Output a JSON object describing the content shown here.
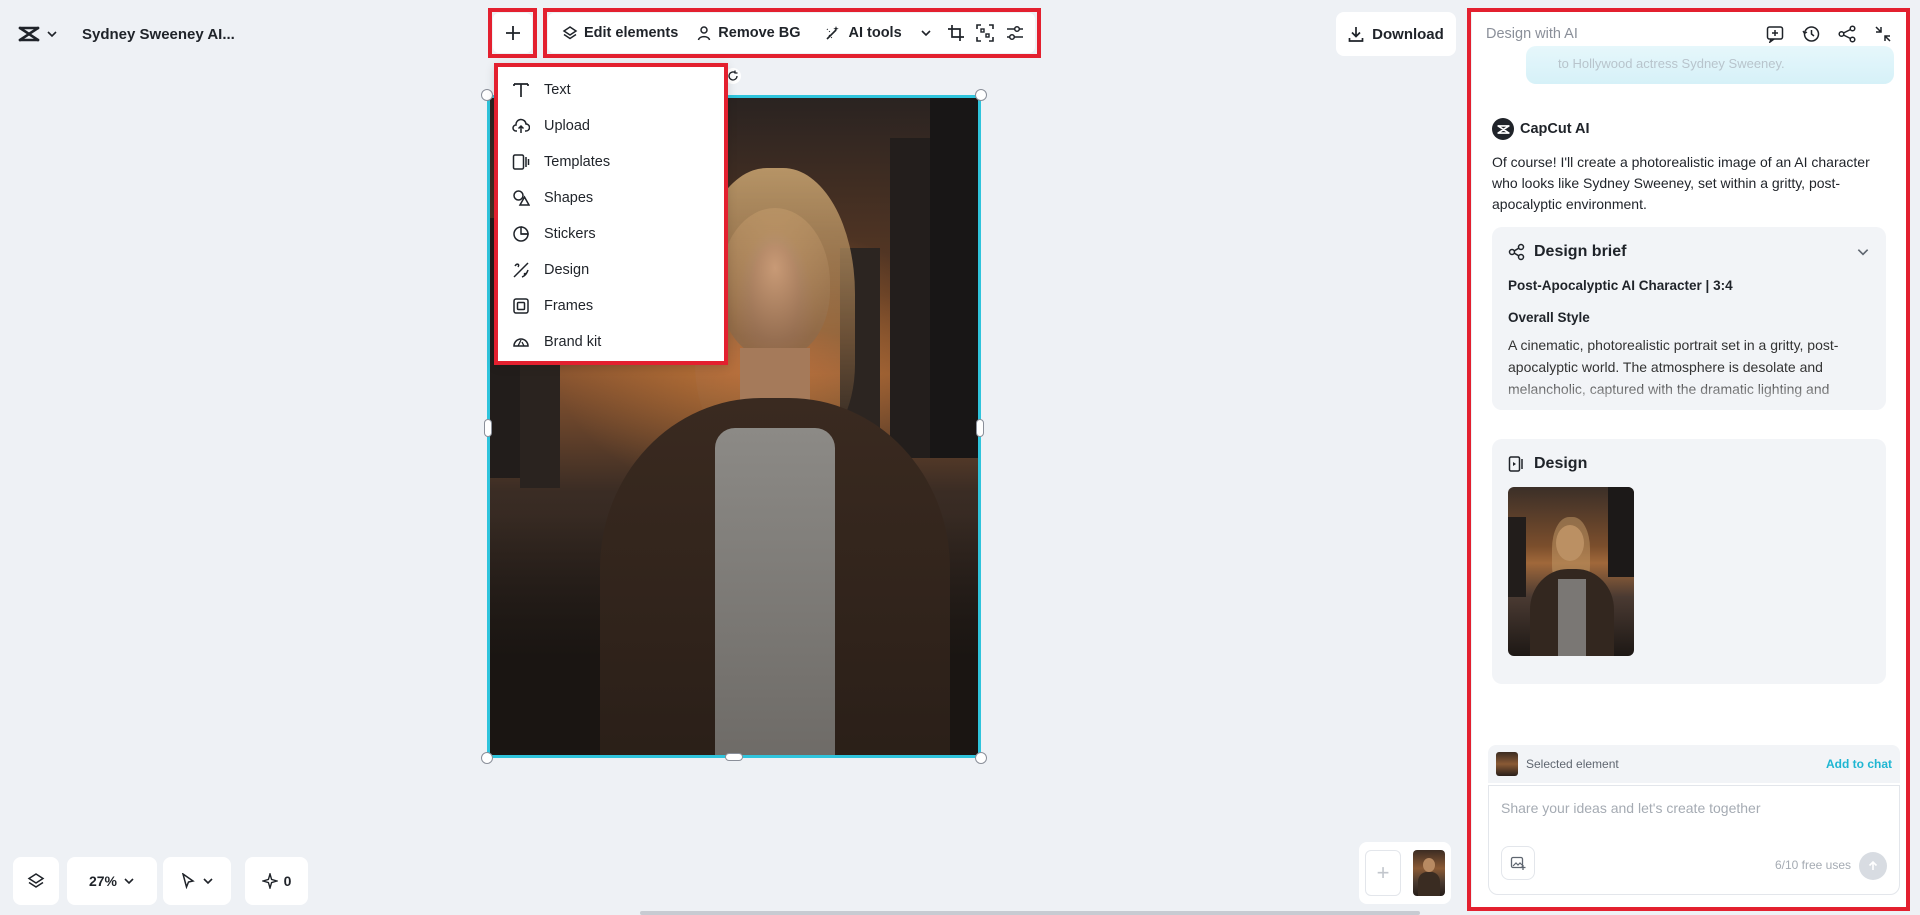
{
  "project": {
    "title": "Sydney Sweeney AI..."
  },
  "toolbar": {
    "edit_elements": "Edit elements",
    "remove_bg": "Remove BG",
    "ai_tools": "AI tools"
  },
  "download_label": "Download",
  "add_menu": {
    "items": [
      {
        "label": "Text",
        "icon": "text-icon"
      },
      {
        "label": "Upload",
        "icon": "upload-icon"
      },
      {
        "label": "Templates",
        "icon": "templates-icon"
      },
      {
        "label": "Shapes",
        "icon": "shapes-icon"
      },
      {
        "label": "Stickers",
        "icon": "stickers-icon"
      },
      {
        "label": "Design",
        "icon": "design-icon"
      },
      {
        "label": "Frames",
        "icon": "frames-icon"
      },
      {
        "label": "Brand kit",
        "icon": "brand-kit-icon"
      }
    ]
  },
  "bottom": {
    "zoom": "27%",
    "ai_count": "0"
  },
  "panel": {
    "title": "Design with AI",
    "user_bubble": "to Hollywood actress Sydney Sweeney.",
    "ai_name": "CapCut AI",
    "ai_message": "Of course! I'll create a photorealistic image of an AI character who looks like Sydney Sweeney, set within a gritty, post-apocalyptic environment.",
    "brief": {
      "heading": "Design brief",
      "subtitle": "Post-Apocalyptic AI Character | 3:4",
      "section": "Overall Style",
      "text": "A cinematic, photorealistic portrait set in a gritty, post-apocalyptic world. The atmosphere is desolate and melancholic, captured with the dramatic lighting and"
    },
    "design_heading": "Design",
    "selected_label": "Selected element",
    "add_to_chat": "Add to chat",
    "input_placeholder": "Share your ideas and let's create together",
    "free_uses": "6/10 free uses"
  },
  "colors": {
    "highlight": "#e3202f",
    "selection": "#2fc4dc",
    "accent": "#1fb6d2"
  }
}
